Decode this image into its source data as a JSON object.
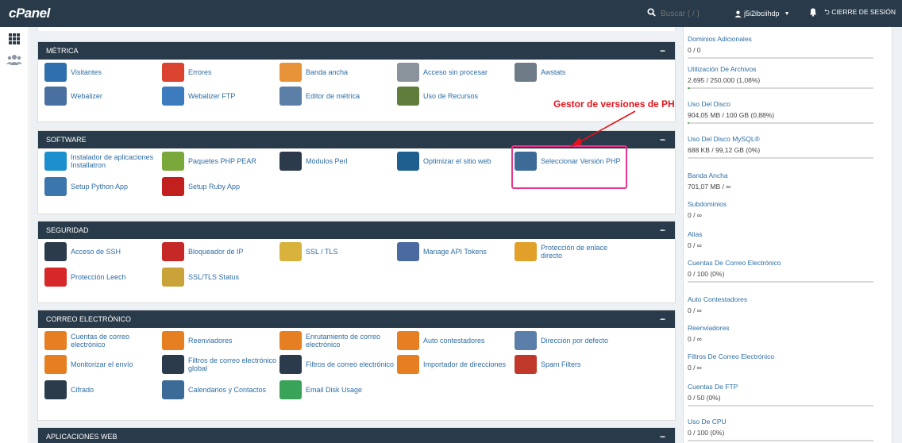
{
  "brand": "cPanel",
  "header": {
    "search_placeholder": "Buscar ( / )",
    "username": "j5i2ibciihdp",
    "logout_label": "CIERRE DE SESIÓN"
  },
  "annotation": {
    "text": "Gestor de versiones de PH",
    "color": "#e5121b"
  },
  "sections": [
    {
      "title": "MÉTRICA",
      "items": [
        {
          "label": "Visitantes",
          "icon": "visitors-icon",
          "color": "#2f6fae"
        },
        {
          "label": "Errores",
          "icon": "errors-icon",
          "color": "#d9432f"
        },
        {
          "label": "Banda ancha",
          "icon": "bandwidth-icon",
          "color": "#e8923a"
        },
        {
          "label": "Acceso sin procesar",
          "icon": "raw-access-icon",
          "color": "#8a939b"
        },
        {
          "label": "Awstats",
          "icon": "awstats-icon",
          "color": "#6d7b86"
        },
        {
          "label": "Webalizer",
          "icon": "webalizer-icon",
          "color": "#4a6fa1"
        },
        {
          "label": "Webalizer FTP",
          "icon": "webalizer-ftp-icon",
          "color": "#3c7bbd"
        },
        {
          "label": "Editor de métrica",
          "icon": "metrics-editor-icon",
          "color": "#5b7fa6"
        },
        {
          "label": "Uso de Recursos",
          "icon": "resource-usage-icon",
          "color": "#607d3b"
        }
      ]
    },
    {
      "title": "SOFTWARE",
      "items": [
        {
          "label": "Instalador de aplicaciones Installatron",
          "icon": "installatron-icon",
          "color": "#1c8fce"
        },
        {
          "label": "Paquetes PHP PEAR",
          "icon": "php-pear-icon",
          "color": "#7aa83a"
        },
        {
          "label": "Módulos Perl",
          "icon": "perl-modules-icon",
          "color": "#2b3b4b"
        },
        {
          "label": "Optimizar el sitio web",
          "icon": "optimize-website-icon",
          "color": "#1f5f8f"
        },
        {
          "label": "Seleccionar Versión PHP",
          "icon": "php-version-icon",
          "color": "#3d6b98"
        },
        {
          "label": "Setup Python App",
          "icon": "python-icon",
          "color": "#3b76ad"
        },
        {
          "label": "Setup Ruby App",
          "icon": "ruby-icon",
          "color": "#c21f1f"
        }
      ]
    },
    {
      "title": "SEGURIDAD",
      "items": [
        {
          "label": "Acceso de SSH",
          "icon": "ssh-icon",
          "color": "#2b3b4b"
        },
        {
          "label": "Bloqueador de IP",
          "icon": "ip-blocker-icon",
          "color": "#c62828"
        },
        {
          "label": "SSL / TLS",
          "icon": "ssl-tls-icon",
          "color": "#d8b23a"
        },
        {
          "label": "Manage API Tokens",
          "icon": "api-tokens-icon",
          "color": "#4a6aa0"
        },
        {
          "label": "Protección de enlace directo",
          "icon": "hotlink-protection-icon",
          "color": "#e0a02a"
        },
        {
          "label": "Protección Leech",
          "icon": "leech-protection-icon",
          "color": "#d62828"
        },
        {
          "label": "SSL/TLS Status",
          "icon": "ssl-status-icon",
          "color": "#c9a33a"
        }
      ]
    },
    {
      "title": "CORREO ELECTRÓNICO",
      "items": [
        {
          "label": "Cuentas de correo electrónico",
          "icon": "email-accounts-icon",
          "color": "#e67e22"
        },
        {
          "label": "Reenviadores",
          "icon": "forwarders-icon",
          "color": "#e67e22"
        },
        {
          "label": "Enrutamiento de correo electrónico",
          "icon": "email-routing-icon",
          "color": "#e67e22"
        },
        {
          "label": "Auto contestadores",
          "icon": "autoresponders-icon",
          "color": "#e67e22"
        },
        {
          "label": "Dirección por defecto",
          "icon": "default-address-icon",
          "color": "#5a7fa8"
        },
        {
          "label": "Monitorizar el envío",
          "icon": "track-delivery-icon",
          "color": "#e67e22"
        },
        {
          "label": "Filtros de correo electrónico global",
          "icon": "global-email-filters-icon",
          "color": "#2b3b4b"
        },
        {
          "label": "Filtros de correo electrónico",
          "icon": "email-filters-icon",
          "color": "#2b3b4b"
        },
        {
          "label": "Importador de direcciones",
          "icon": "address-importer-icon",
          "color": "#e67e22"
        },
        {
          "label": "Spam Filters",
          "icon": "spam-filters-icon",
          "color": "#c0392b"
        },
        {
          "label": "Cifrado",
          "icon": "encryption-icon",
          "color": "#2b3b4b"
        },
        {
          "label": "Calendarios y Contactos",
          "icon": "calendars-contacts-icon",
          "color": "#3d6b98"
        },
        {
          "label": "Email Disk Usage",
          "icon": "email-disk-usage-icon",
          "color": "#3aa35a"
        }
      ]
    },
    {
      "title": "APLICACIONES WEB",
      "items": []
    }
  ],
  "stats": [
    {
      "label": "Dominios Adicionales",
      "value": "0 / 0",
      "fill": 0
    },
    {
      "label": "Utilización De Archivos",
      "value": "2.695 / 250.000   (1,08%)",
      "fill": 0.0108
    },
    {
      "label": "Uso Del Disco",
      "value": "904,05 MB / 100 GB   (0,88%)",
      "fill": 0.0088
    },
    {
      "label": "Uso Del Disco MySQL®",
      "value": "688 KB / 99,12 GB   (0%)",
      "fill": 0
    },
    {
      "label": "Banda Ancha",
      "value": "701,07 MB / ∞",
      "fill": null
    },
    {
      "label": "Subdominios",
      "value": "0 / ∞",
      "fill": null
    },
    {
      "label": "Alias",
      "value": "0 / ∞",
      "fill": null
    },
    {
      "label": "Cuentas De Correo Electrónico",
      "value": "0 / 100   (0%)",
      "fill": 0
    },
    {
      "label": "Auto Contestadores",
      "value": "0 / ∞",
      "fill": null
    },
    {
      "label": "Reenviadores",
      "value": "0 / ∞",
      "fill": null
    },
    {
      "label": "Filtros De Correo Electrónico",
      "value": "0 / ∞",
      "fill": null
    },
    {
      "label": "Cuentas De FTP",
      "value": "0 / 50   (0%)",
      "fill": 0
    },
    {
      "label": "Uso De CPU",
      "value": "0 / 100   (0%)",
      "fill": 0
    }
  ]
}
